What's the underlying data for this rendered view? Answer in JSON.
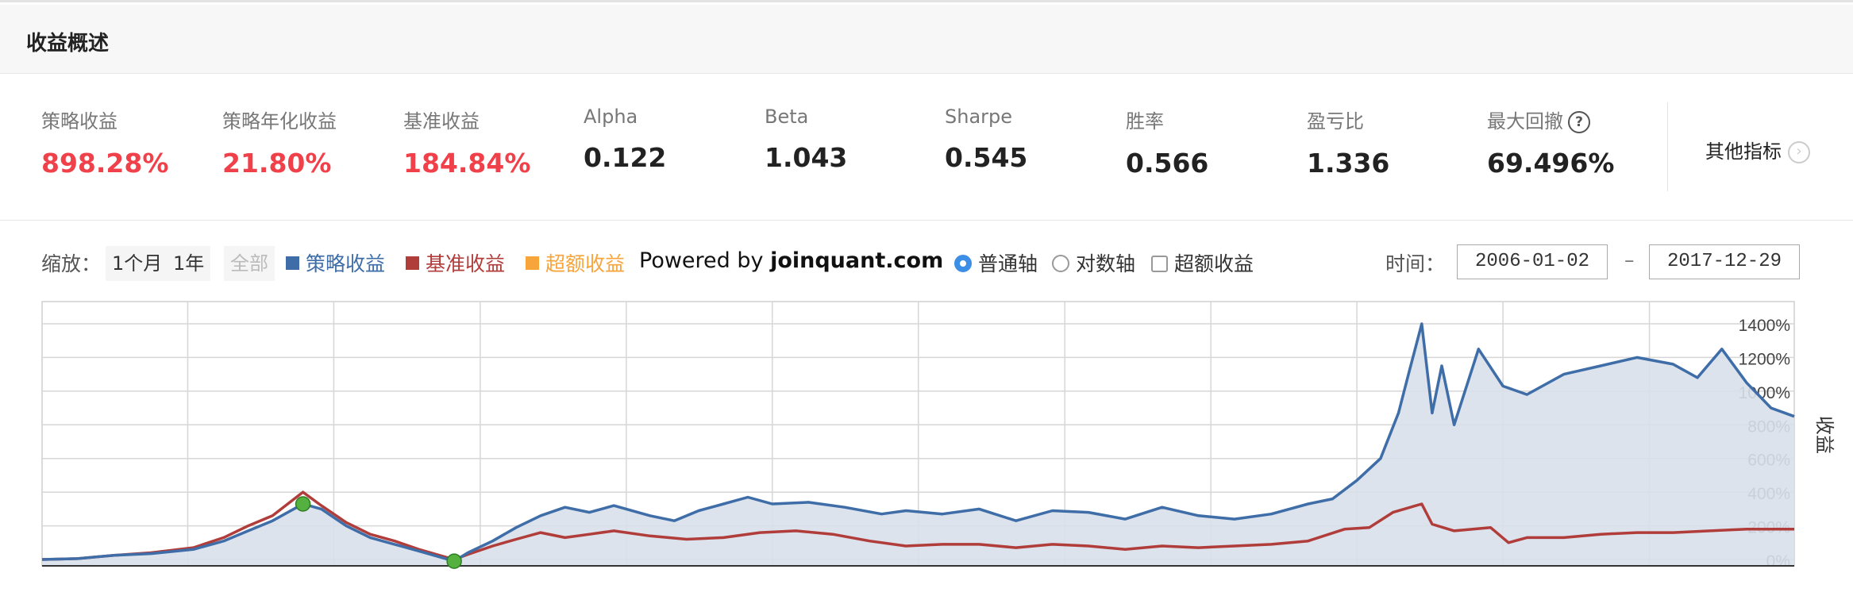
{
  "header": {
    "title": "收益概述"
  },
  "metrics": [
    {
      "label": "策略收益",
      "value": "898.28%",
      "highlight": true
    },
    {
      "label": "策略年化收益",
      "value": "21.80%",
      "highlight": true
    },
    {
      "label": "基准收益",
      "value": "184.84%",
      "highlight": true
    },
    {
      "label": "Alpha",
      "value": "0.122",
      "highlight": false
    },
    {
      "label": "Beta",
      "value": "1.043",
      "highlight": false
    },
    {
      "label": "Sharpe",
      "value": "0.545",
      "highlight": false
    },
    {
      "label": "胜率",
      "value": "0.566",
      "highlight": false
    },
    {
      "label": "盈亏比",
      "value": "1.336",
      "highlight": false
    },
    {
      "label": "最大回撤",
      "value": "69.496%",
      "highlight": false,
      "help_icon": "question-icon"
    }
  ],
  "more_metrics": {
    "label": "其他指标",
    "icon": "chevron-right-icon"
  },
  "toolbar": {
    "zoom_label": "缩放：",
    "zoom_buttons": [
      {
        "label": "1个月",
        "enabled": true
      },
      {
        "label": "1年",
        "enabled": true
      },
      {
        "label": "全部",
        "enabled": false
      }
    ],
    "legend": [
      {
        "label": "策略收益",
        "color": "#3e6da8"
      },
      {
        "label": "基准收益",
        "color": "#b13d3b"
      },
      {
        "label": "超额收益",
        "color": "#f7a43b"
      }
    ],
    "powered_prefix": "Powered by ",
    "powered_site": "joinquant.com",
    "axis_options": [
      {
        "label": "普通轴",
        "selected": true
      },
      {
        "label": "对数轴",
        "selected": false
      }
    ],
    "excess_checkbox": {
      "label": "超额收益",
      "checked": false
    },
    "time_label": "时间：",
    "start_date": "2006-01-02",
    "end_date": "2017-12-29",
    "date_separator": "–"
  },
  "chart_data": {
    "type": "area",
    "xlabel": "",
    "ylabel": "收益",
    "x_range": [
      "2006-01-02",
      "2017-12-29"
    ],
    "ylim": [
      0,
      1400
    ],
    "yticks": [
      0,
      200,
      400,
      600,
      800,
      1000,
      1200,
      1400
    ],
    "ytick_labels": [
      "0%",
      "200%",
      "400%",
      "600%",
      "800%",
      "1000%",
      "1200%",
      "1400%"
    ],
    "grid": true,
    "series": [
      {
        "name": "策略收益",
        "color": "#3e6da8",
        "fill": "#d8e0eb",
        "x": [
          "2006-01-02",
          "2006-04-01",
          "2006-07-01",
          "2006-10-01",
          "2007-01-15",
          "2007-04-01",
          "2007-06-01",
          "2007-08-01",
          "2007-10-16",
          "2007-12-01",
          "2008-02-01",
          "2008-04-01",
          "2008-06-01",
          "2008-08-01",
          "2008-10-28",
          "2008-12-01",
          "2009-02-01",
          "2009-04-01",
          "2009-06-01",
          "2009-08-01",
          "2009-10-01",
          "2009-12-01",
          "2010-03-01",
          "2010-05-01",
          "2010-07-01",
          "2010-09-01",
          "2010-11-01",
          "2011-01-01",
          "2011-04-01",
          "2011-07-01",
          "2011-10-01",
          "2011-12-01",
          "2012-03-01",
          "2012-06-01",
          "2012-09-01",
          "2012-12-01",
          "2013-03-01",
          "2013-06-01",
          "2013-09-01",
          "2013-12-01",
          "2014-03-01",
          "2014-06-01",
          "2014-09-01",
          "2014-11-01",
          "2015-01-01",
          "2015-03-01",
          "2015-04-15",
          "2015-05-10",
          "2015-06-12",
          "2015-07-08",
          "2015-08-01",
          "2015-09-01",
          "2015-11-01",
          "2016-01-01",
          "2016-03-01",
          "2016-06-01",
          "2016-09-01",
          "2016-12-01",
          "2017-03-01",
          "2017-05-01",
          "2017-07-01",
          "2017-09-01",
          "2017-11-01",
          "2017-12-29"
        ],
        "values": [
          0,
          5,
          25,
          35,
          60,
          110,
          170,
          230,
          330,
          300,
          200,
          130,
          90,
          50,
          -10,
          40,
          110,
          190,
          260,
          310,
          280,
          320,
          260,
          230,
          290,
          330,
          370,
          330,
          340,
          310,
          270,
          290,
          270,
          300,
          230,
          290,
          280,
          240,
          310,
          260,
          240,
          270,
          330,
          360,
          470,
          600,
          870,
          1100,
          1400,
          870,
          1150,
          800,
          1250,
          1030,
          980,
          1100,
          1150,
          1200,
          1160,
          1080,
          1250,
          1050,
          900,
          850
        ]
      },
      {
        "name": "基准收益",
        "color": "#b13d3b",
        "x": [
          "2006-01-02",
          "2006-04-01",
          "2006-07-01",
          "2006-10-01",
          "2007-01-15",
          "2007-04-01",
          "2007-06-01",
          "2007-08-01",
          "2007-10-16",
          "2007-12-01",
          "2008-02-01",
          "2008-04-01",
          "2008-06-01",
          "2008-08-01",
          "2008-10-28",
          "2008-12-01",
          "2009-02-01",
          "2009-04-01",
          "2009-06-01",
          "2009-08-01",
          "2009-10-01",
          "2009-12-01",
          "2010-03-01",
          "2010-06-01",
          "2010-09-01",
          "2010-12-01",
          "2011-03-01",
          "2011-06-01",
          "2011-09-01",
          "2011-12-01",
          "2012-03-01",
          "2012-06-01",
          "2012-09-01",
          "2012-12-01",
          "2013-03-01",
          "2013-06-01",
          "2013-09-01",
          "2013-12-01",
          "2014-03-01",
          "2014-06-01",
          "2014-09-01",
          "2014-12-01",
          "2015-02-01",
          "2015-04-01",
          "2015-06-12",
          "2015-07-08",
          "2015-09-01",
          "2015-12-01",
          "2016-01-15",
          "2016-03-01",
          "2016-06-01",
          "2016-09-01",
          "2016-12-01",
          "2017-03-01",
          "2017-06-01",
          "2017-09-01",
          "2017-12-29"
        ],
        "values": [
          0,
          5,
          25,
          40,
          70,
          130,
          200,
          260,
          400,
          320,
          220,
          150,
          110,
          60,
          0,
          30,
          80,
          120,
          160,
          130,
          150,
          170,
          140,
          120,
          130,
          160,
          170,
          150,
          110,
          80,
          90,
          90,
          70,
          90,
          80,
          60,
          80,
          70,
          80,
          90,
          110,
          180,
          190,
          280,
          330,
          210,
          170,
          190,
          100,
          130,
          130,
          150,
          160,
          160,
          170,
          180,
          180
        ]
      }
    ],
    "markers": [
      {
        "series": "策略收益",
        "x": "2007-10-16",
        "y": 330,
        "color": "#55b13f"
      },
      {
        "series": "策略收益",
        "x": "2008-10-28",
        "y": -10,
        "color": "#55b13f"
      }
    ]
  }
}
